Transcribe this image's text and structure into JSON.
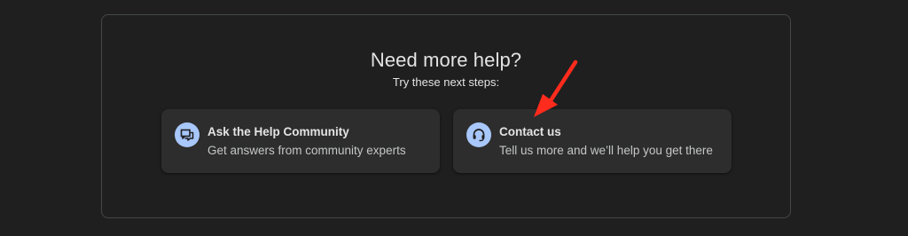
{
  "help": {
    "title": "Need more help?",
    "subtitle": "Try these next steps:",
    "cards": [
      {
        "title": "Ask the Help Community",
        "description": "Get answers from community experts",
        "icon": "forum-icon"
      },
      {
        "title": "Contact us",
        "description": "Tell us more and we’ll help you get there",
        "icon": "headset-icon"
      }
    ]
  },
  "colors": {
    "background": "#1f1f1f",
    "card": "#2d2d2d",
    "icon_circle": "#a8c7fa",
    "annotation_arrow": "#ff2b1c"
  }
}
